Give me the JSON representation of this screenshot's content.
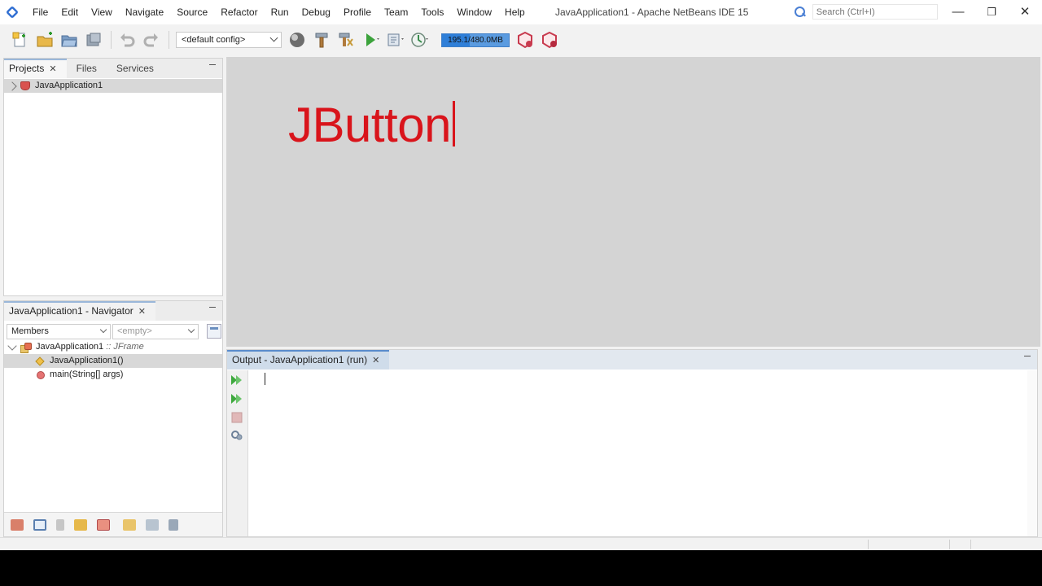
{
  "window": {
    "title": "JavaApplication1 - Apache NetBeans IDE 15",
    "controls": [
      "minimize",
      "restore",
      "close"
    ]
  },
  "menu": {
    "items": [
      "File",
      "Edit",
      "View",
      "Navigate",
      "Source",
      "Refactor",
      "Run",
      "Debug",
      "Profile",
      "Team",
      "Tools",
      "Window",
      "Help"
    ]
  },
  "search": {
    "placeholder": "Search (Ctrl+I)"
  },
  "toolbar": {
    "icons": [
      "new-file-icon",
      "new-project-icon",
      "open-project-icon",
      "close-project-icon",
      "undo-icon",
      "redo-icon",
      "globe-icon",
      "build-hammer-icon",
      "clean-build-icon",
      "run-icon",
      "debug-icon",
      "profile-icon",
      "gc-icon",
      "profile-snapshot-icon"
    ],
    "config_value": "<default config>",
    "memory_label": "195.1/480.0MB",
    "memory_fraction": 0.41
  },
  "projects_panel": {
    "tabs": [
      {
        "label": "Projects",
        "active": true,
        "closable": true
      },
      {
        "label": "Files",
        "active": false,
        "closable": false
      },
      {
        "label": "Services",
        "active": false,
        "closable": false
      }
    ],
    "tree": [
      {
        "label": "JavaApplication1",
        "icon": "java-project-icon",
        "expanded": false
      }
    ]
  },
  "navigator_panel": {
    "tab_label": "JavaApplication1 - Navigator",
    "members_select": "Members",
    "filter_select": "<empty>",
    "root": {
      "label": "JavaApplication1",
      "suffix": ":: JFrame"
    },
    "members": [
      {
        "label": "JavaApplication1()",
        "icon": "constructor-icon",
        "selected": true
      },
      {
        "label": "main(String[] args)",
        "icon": "method-icon",
        "selected": false
      }
    ],
    "footer_icons": [
      "fields-filter-icon",
      "static-filter-icon",
      "non-public-filter-icon",
      "inherited-filter-icon",
      "class-filter-icon",
      "sort-by-source-icon",
      "sort-by-name-icon",
      "sort-alpha-icon"
    ]
  },
  "editor": {
    "overlay_text": "JButton",
    "overlay_color": "#d9141b"
  },
  "output_panel": {
    "tab_label": "Output - JavaApplication1 (run)",
    "gutter_buttons": [
      "rerun-icon",
      "rerun-with-params-icon",
      "stop-icon",
      "settings-icon"
    ]
  }
}
